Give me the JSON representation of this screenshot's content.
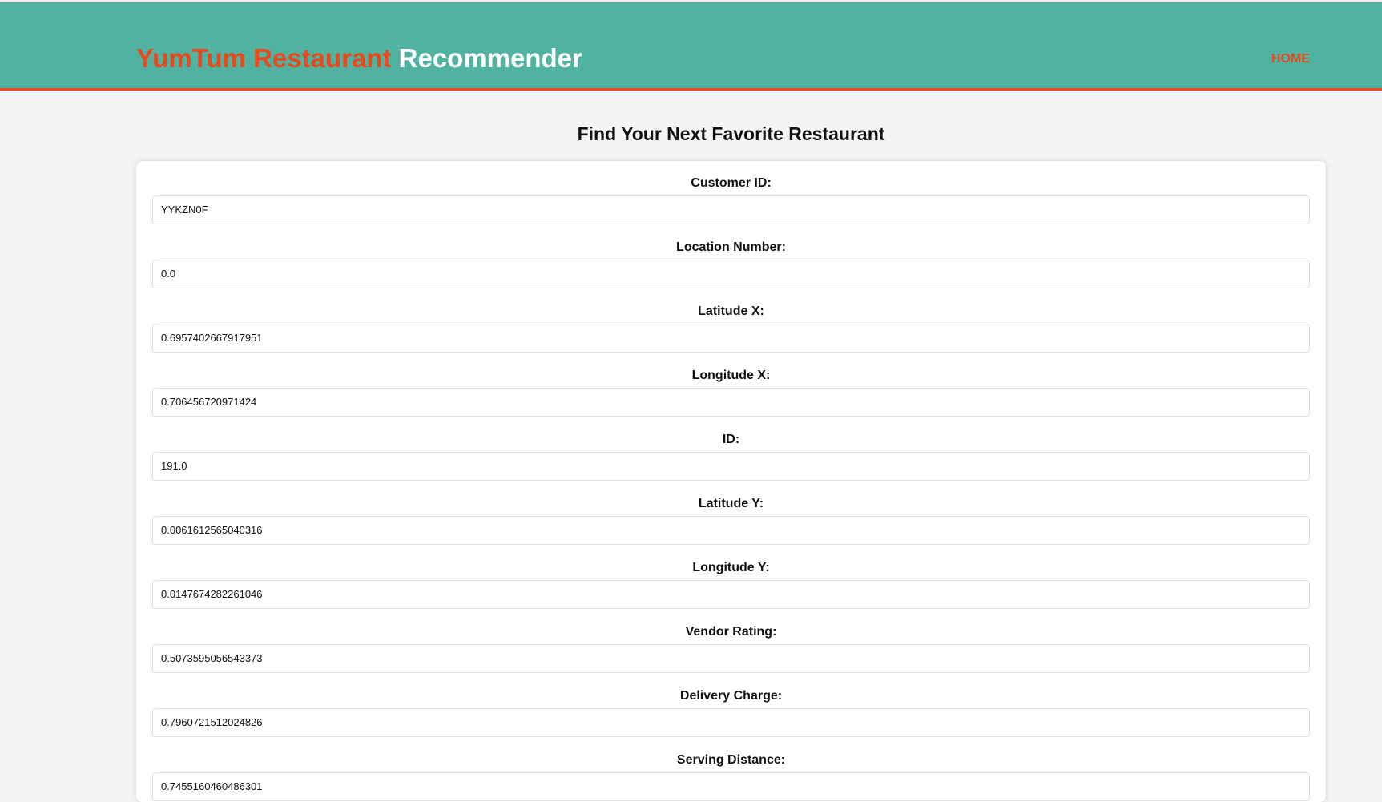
{
  "header": {
    "brand_highlight": "YumTum Restaurant",
    "brand_rest": "Recommender",
    "nav": [
      {
        "label": "HOME"
      }
    ],
    "colors": {
      "header_bg": "#50b3a2",
      "accent": "#e8491d"
    }
  },
  "main": {
    "title": "Find Your Next Favorite Restaurant",
    "fields": [
      {
        "label": "Customer ID:",
        "value": "YYKZN0F"
      },
      {
        "label": "Location Number:",
        "value": "0.0"
      },
      {
        "label": "Latitude X:",
        "value": "0.6957402667917951"
      },
      {
        "label": "Longitude X:",
        "value": "0.706456720971424"
      },
      {
        "label": "ID:",
        "value": "191.0"
      },
      {
        "label": "Latitude Y:",
        "value": "0.0061612565040316"
      },
      {
        "label": "Longitude Y:",
        "value": "0.0147674282261046"
      },
      {
        "label": "Vendor Rating:",
        "value": "0.5073595056543373"
      },
      {
        "label": "Delivery Charge:",
        "value": "0.7960721512024826"
      },
      {
        "label": "Serving Distance:",
        "value": "0.7455160460486301"
      }
    ]
  }
}
